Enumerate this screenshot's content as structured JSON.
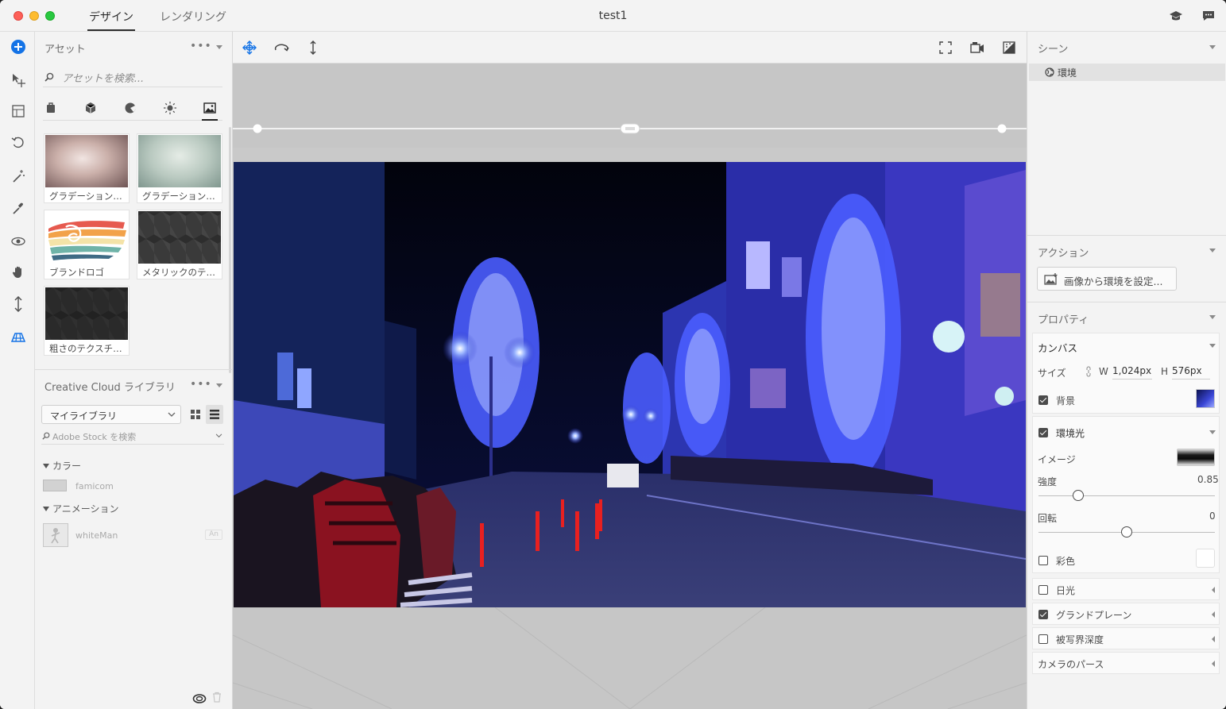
{
  "window": {
    "title": "test1"
  },
  "tabs": [
    {
      "label": "デザイン",
      "active": true
    },
    {
      "label": "レンダリング",
      "active": false
    }
  ],
  "titlebar_icons": [
    "learn-icon",
    "feedback-icon"
  ],
  "tools": [
    "add-icon",
    "select-move-icon",
    "frame-icon",
    "rotate-icon",
    "magic-wand-icon",
    "eyedropper-icon",
    "orbit-icon",
    "pan-hand-icon",
    "dolly-icon",
    "camera-bookmark-icon"
  ],
  "assets": {
    "title": "アセット",
    "more": "•••",
    "search_placeholder": "アセットを検索...",
    "categories": [
      "model-icon",
      "material-icon",
      "paint-icon",
      "light-icon",
      "image-icon"
    ],
    "active_category": "image-icon",
    "items": [
      {
        "label": "グラデーション…"
      },
      {
        "label": "グラデーション…"
      },
      {
        "label": "ブランドロゴ"
      },
      {
        "label": "メタリックのテ…"
      },
      {
        "label": "粗さのテクスチ…"
      }
    ]
  },
  "cc_library": {
    "title": "Creative Cloud ライブラリ",
    "more": "•••",
    "library_select": "マイライブラリ",
    "stock_placeholder": "Adobe Stock を検索",
    "groups": [
      {
        "name": "カラー",
        "item": "famicom"
      },
      {
        "name": "アニメーション",
        "item": "whiteMan",
        "badge": "An"
      }
    ]
  },
  "scene": {
    "title": "シーン",
    "items": [
      {
        "label": "環境"
      }
    ]
  },
  "actions": {
    "title": "アクション",
    "button": "画像から環境を設定..."
  },
  "properties": {
    "title": "プロパティ",
    "canvas": {
      "title": "カンバス",
      "size_label": "サイズ",
      "w_label": "W",
      "w_value": "1,024px",
      "h_label": "H",
      "h_value": "576px",
      "background_label": "背景",
      "background_checked": true
    },
    "environment_light": {
      "title": "環境光",
      "checked": true,
      "image_label": "イメージ",
      "intensity_label": "強度",
      "intensity_value": "0.85",
      "rotation_label": "回転",
      "rotation_value": "0",
      "tint_label": "彩色",
      "tint_checked": false
    },
    "sections": [
      {
        "label": "日光",
        "checked": false
      },
      {
        "label": "グランドプレーン",
        "checked": true
      },
      {
        "label": "被写界深度",
        "checked": false
      },
      {
        "label": "カメラのパース"
      }
    ]
  },
  "colors": {
    "accent": "#1473e6",
    "swatch": "#d2d2d2"
  }
}
